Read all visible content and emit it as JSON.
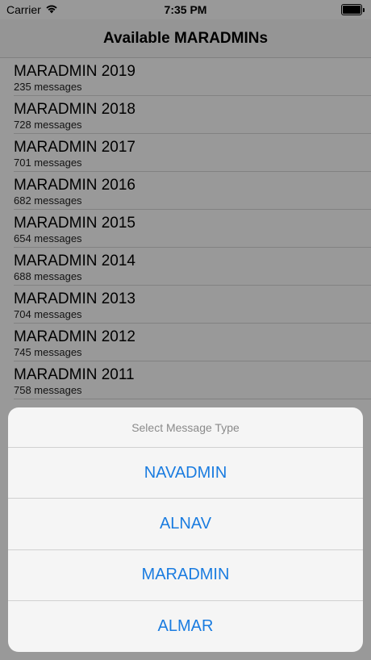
{
  "status_bar": {
    "carrier": "Carrier",
    "time": "7:35 PM",
    "wifi_icon": "wifi-icon",
    "battery_icon": "battery-icon"
  },
  "nav": {
    "title": "Available MARADMINs"
  },
  "list": [
    {
      "title": "MARADMIN 2019",
      "count": "235 messages"
    },
    {
      "title": "MARADMIN 2018",
      "count": "728 messages"
    },
    {
      "title": "MARADMIN 2017",
      "count": "701 messages"
    },
    {
      "title": "MARADMIN 2016",
      "count": "682 messages"
    },
    {
      "title": "MARADMIN 2015",
      "count": "654 messages"
    },
    {
      "title": "MARADMIN 2014",
      "count": "688 messages"
    },
    {
      "title": "MARADMIN 2013",
      "count": "704 messages"
    },
    {
      "title": "MARADMIN 2012",
      "count": "745 messages"
    },
    {
      "title": "MARADMIN 2011",
      "count": "758 messages"
    }
  ],
  "action_sheet": {
    "title": "Select Message Type",
    "options": [
      "NAVADMIN",
      "ALNAV",
      "MARADMIN",
      "ALMAR"
    ]
  },
  "colors": {
    "accent": "#1a7ce0",
    "overlay": "rgba(0,0,0,0.40)"
  }
}
